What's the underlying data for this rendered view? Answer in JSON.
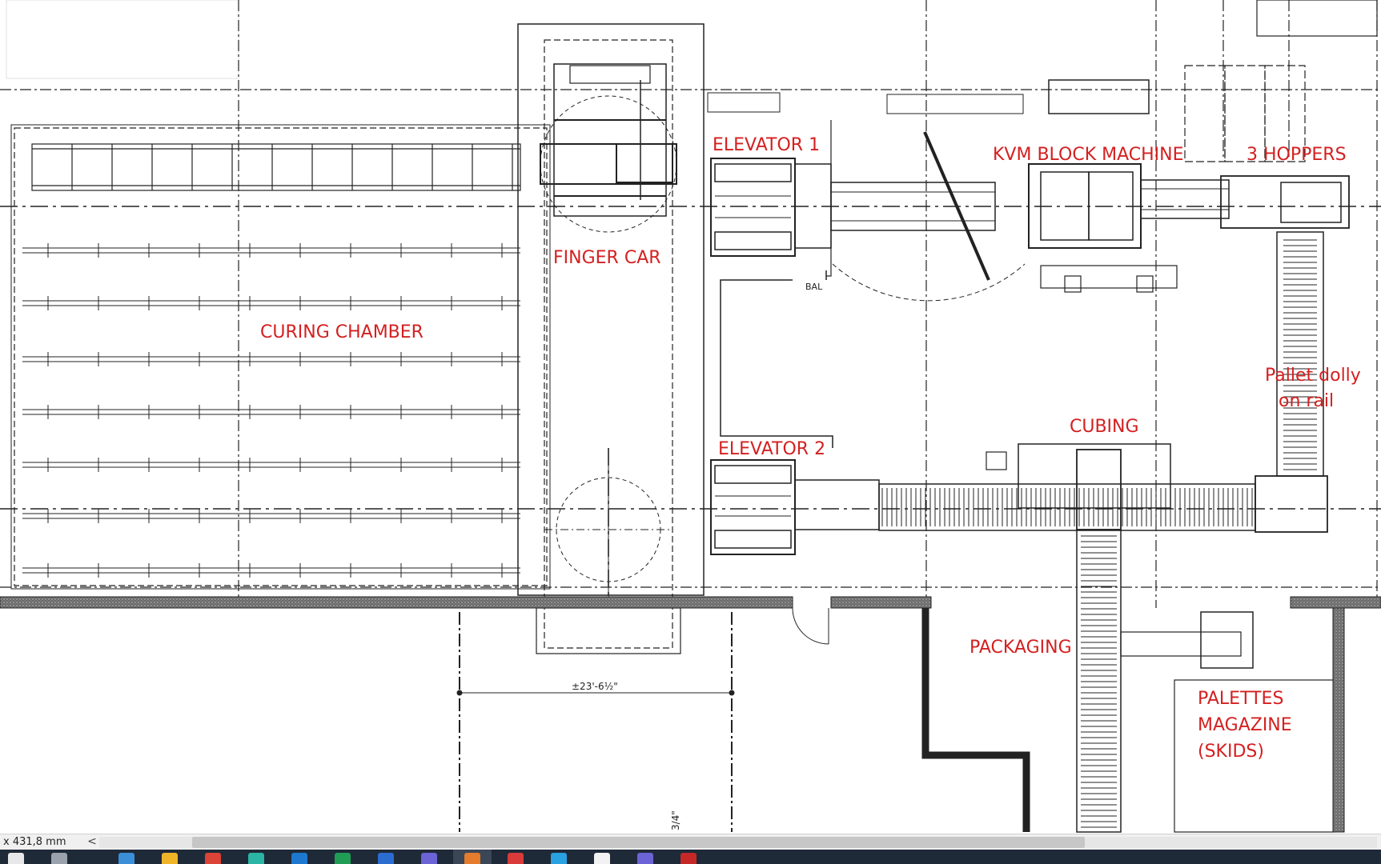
{
  "labels": {
    "curing_chamber": "CURING CHAMBER",
    "finger_car": "FINGER CAR",
    "elevator_1": "ELEVATOR 1",
    "elevator_2": "ELEVATOR 2",
    "kvm_block_machine": "KVM BLOCK MACHINE",
    "hoppers": "3 HOPPERS",
    "pallet_dolly_line1": "Pallet dolly",
    "pallet_dolly_line2": "on rail",
    "cubing": "CUBING",
    "packaging": "PACKAGING",
    "palettes_line1": "PALETTES",
    "palettes_line2": "MAGAZINE",
    "palettes_line3": "(SKIDS)"
  },
  "drawing_text": {
    "bal": "BAL",
    "dimension": "±23'-6½\"",
    "margin_mark": "3/4\""
  },
  "status_bar": {
    "coordinate": "x 431,8 mm",
    "scroll_left": "<"
  },
  "colors": {
    "label_red": "#d42020",
    "line": "#1a1a1a",
    "wall": "#3a3a3a",
    "taskbar": "#1f2a38"
  },
  "taskbar": {
    "icons": [
      "search-icon",
      "task-view-icon",
      "file-explorer-icon",
      "folder-icon",
      "chrome-icon",
      "edge-icon",
      "outlook-icon",
      "excel-icon",
      "word-icon",
      "teams-icon",
      "cad-app-icon",
      "red-app-icon",
      "telegram-icon",
      "camera-icon",
      "teams-alt-icon",
      "pdf-icon"
    ]
  }
}
